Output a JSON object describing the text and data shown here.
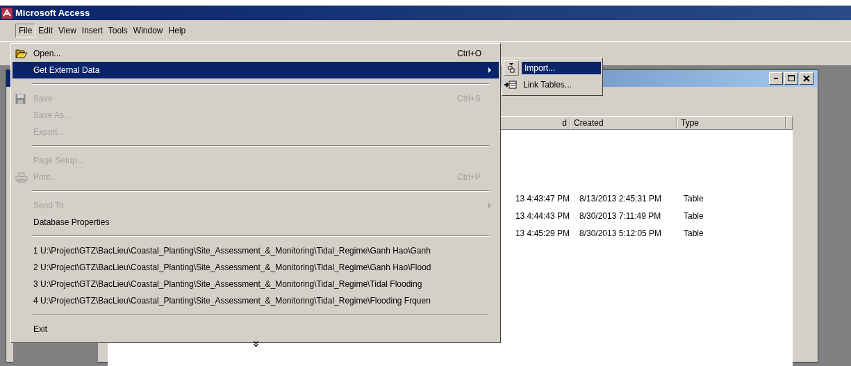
{
  "window": {
    "title": "Microsoft Access"
  },
  "menu_bar": [
    {
      "label": "File",
      "selected": true
    },
    {
      "label": "Edit",
      "selected": false
    },
    {
      "label": "View",
      "selected": false
    },
    {
      "label": "Insert",
      "selected": false
    },
    {
      "label": "Tools",
      "selected": false
    },
    {
      "label": "Window",
      "selected": false
    },
    {
      "label": "Help",
      "selected": false
    }
  ],
  "file_menu": [
    {
      "kind": "item",
      "label": "Open...",
      "shortcut": "Ctrl+O",
      "disabled": false,
      "selected": false,
      "submenu": false
    },
    {
      "kind": "item",
      "label": "Get External Data",
      "disabled": false,
      "selected": true,
      "submenu": true
    },
    {
      "kind": "separator"
    },
    {
      "kind": "item",
      "label": "Save",
      "shortcut": "Ctrl+S",
      "disabled": true,
      "selected": false,
      "submenu": false
    },
    {
      "kind": "item",
      "label": "Save As...",
      "disabled": true,
      "selected": false,
      "submenu": false
    },
    {
      "kind": "item",
      "label": "Export...",
      "disabled": true,
      "selected": false,
      "submenu": false
    },
    {
      "kind": "separator"
    },
    {
      "kind": "item",
      "label": "Page Setup...",
      "disabled": true,
      "selected": false,
      "submenu": false
    },
    {
      "kind": "item",
      "label": "Print...",
      "shortcut": "Ctrl+P",
      "disabled": true,
      "selected": false,
      "submenu": false
    },
    {
      "kind": "separator"
    },
    {
      "kind": "item",
      "label": "Send To",
      "disabled": true,
      "selected": false,
      "submenu": true
    },
    {
      "kind": "item",
      "label": "Database Properties",
      "disabled": false,
      "selected": false,
      "submenu": false
    },
    {
      "kind": "separator"
    },
    {
      "kind": "item",
      "label": "1 U:\\Project\\GTZ\\BacLieu\\Coastal_Planting\\Site_Assessment_&_Monitoring\\Tidal_Regime\\Ganh Hao\\Ganh",
      "disabled": false,
      "selected": false,
      "submenu": false
    },
    {
      "kind": "item",
      "label": "2 U:\\Project\\GTZ\\BacLieu\\Coastal_Planting\\Site_Assessment_&_Monitoring\\Tidal_Regime\\Ganh Hao\\Flood",
      "disabled": false,
      "selected": false,
      "submenu": false
    },
    {
      "kind": "item",
      "label": "3 U:\\Project\\GTZ\\BacLieu\\Coastal_Planting\\Site_Assessment_&_Monitoring\\Tidal_Regime\\Tidal Flooding",
      "disabled": false,
      "selected": false,
      "submenu": false
    },
    {
      "kind": "item",
      "label": "4 U:\\Project\\GTZ\\BacLieu\\Coastal_Planting\\Site_Assessment_&_Monitoring\\Tidal_Regime\\Flooding Frquen",
      "disabled": false,
      "selected": false,
      "submenu": false
    },
    {
      "kind": "separator"
    },
    {
      "kind": "item",
      "label": "Exit",
      "disabled": false,
      "selected": false,
      "submenu": false
    }
  ],
  "submenu": [
    {
      "label": "Import...",
      "selected": true
    },
    {
      "label": "Link Tables...",
      "selected": false
    }
  ],
  "database_window": {
    "columns": [
      "d",
      "Created",
      "Type"
    ],
    "rows": [
      [
        "13 4:43:47 PM",
        "8/13/2013 2:45:31 PM",
        "Table"
      ],
      [
        "13 4:44:43 PM",
        "8/30/2013 7:11:49 PM",
        "Table"
      ],
      [
        "13 4:45:29 PM",
        "8/30/2013 5:12:05 PM",
        "Table"
      ]
    ]
  }
}
